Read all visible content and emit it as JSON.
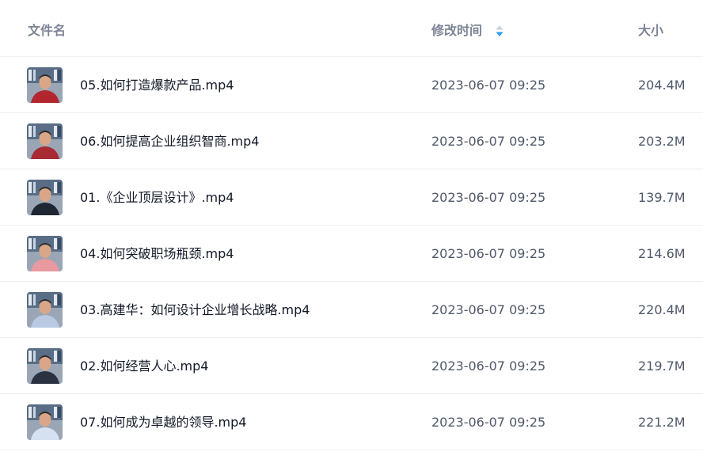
{
  "header": {
    "name_label": "文件名",
    "mtime_label": "修改时间",
    "size_label": "大小",
    "sort_icon": "sort-toggle-icon",
    "sort_accent": "#2a9df4"
  },
  "files": [
    {
      "name": "05.如何打造爆款产品.mp4",
      "mtime": "2023-06-07 09:25",
      "size": "204.4M",
      "thumb_icon": "video-thumbnail",
      "shirt": "#b3262e"
    },
    {
      "name": "06.如何提高企业组织智商.mp4",
      "mtime": "2023-06-07 09:25",
      "size": "203.2M",
      "thumb_icon": "video-thumbnail",
      "shirt": "#a82b33"
    },
    {
      "name": "01.《企业顶层设计》.mp4",
      "mtime": "2023-06-07 09:25",
      "size": "139.7M",
      "thumb_icon": "video-thumbnail",
      "shirt": "#1f2733"
    },
    {
      "name": "04.如何突破职场瓶颈.mp4",
      "mtime": "2023-06-07 09:25",
      "size": "214.6M",
      "thumb_icon": "video-thumbnail",
      "shirt": "#e89aa0"
    },
    {
      "name": "03.高建华：如何设计企业增长战略.mp4",
      "mtime": "2023-06-07 09:25",
      "size": "220.4M",
      "thumb_icon": "video-thumbnail",
      "shirt": "#b9c9e4"
    },
    {
      "name": "02.如何经营人心.mp4",
      "mtime": "2023-06-07 09:25",
      "size": "219.7M",
      "thumb_icon": "video-thumbnail",
      "shirt": "#2a3140"
    },
    {
      "name": "07.如何成为卓越的领导.mp4",
      "mtime": "2023-06-07 09:25",
      "size": "221.2M",
      "thumb_icon": "video-thumbnail",
      "shirt": "#d6e1f2"
    }
  ]
}
